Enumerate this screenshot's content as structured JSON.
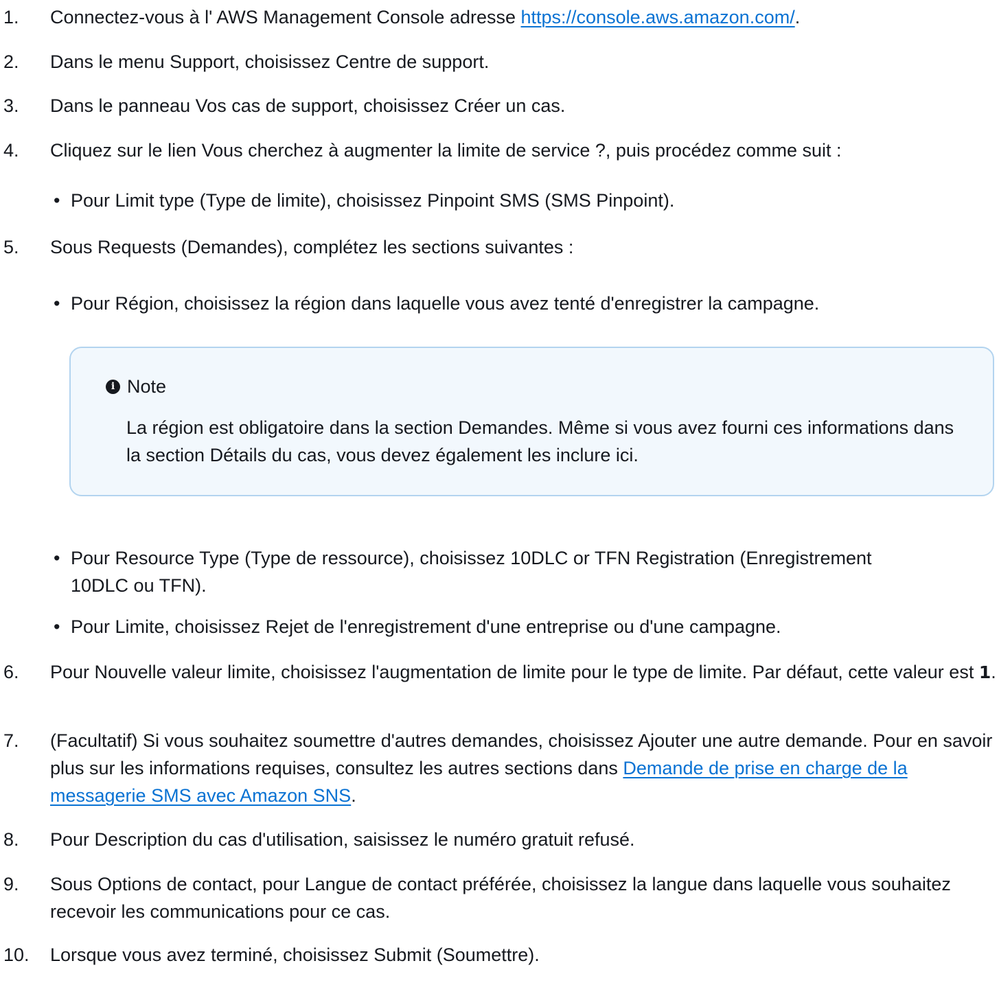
{
  "steps": [
    {
      "num": "1.",
      "before": "Connectez-vous à l' AWS Management Console adresse ",
      "link": "https://console.aws.amazon.com/",
      "after": "."
    },
    {
      "num": "2.",
      "text": "Dans le menu Support, choisissez Centre de support."
    },
    {
      "num": "3.",
      "text": "Dans le panneau Vos cas de support, choisissez Créer un cas."
    },
    {
      "num": "4.",
      "text": "Cliquez sur le lien Vous cherchez à augmenter la limite de service ?, puis procédez comme suit :"
    },
    {
      "num": "5.",
      "text": "Sous Requests (Demandes), complétez les sections suivantes :"
    },
    {
      "num": "6.",
      "before": "Pour Nouvelle valeur limite, choisissez l'augmentation de limite pour le type de limite. Par défaut, cette valeur est ",
      "bold": "1",
      "after": "."
    },
    {
      "num": "7.",
      "before": "(Facultatif) Si vous souhaitez soumettre d'autres demandes, choisissez Ajouter une autre demande. Pour en savoir plus sur les informations requises, consultez les autres sections dans ",
      "link": "Demande de prise en charge de la messagerie SMS avec Amazon SNS",
      "after": "."
    },
    {
      "num": "8.",
      "text": "Pour Description du cas d'utilisation, saisissez le numéro gratuit refusé."
    },
    {
      "num": "9.",
      "text": "Sous Options de contact, pour Langue de contact préférée, choisissez la langue dans laquelle vous souhaitez recevoir les communications pour ce cas."
    },
    {
      "num": "10.",
      "text": "Lorsque vous avez terminé, choisissez Submit (Soumettre)."
    }
  ],
  "bullets": {
    "limit_type": "Pour Limit type (Type de limite), choisissez Pinpoint SMS (SMS Pinpoint).",
    "region": "Pour Région, choisissez la région dans laquelle vous avez tenté d'enregistrer la campagne.",
    "resource_type": "Pour Resource Type (Type de ressource), choisissez 10DLC or TFN Registration (Enregistrement 10DLC ou TFN).",
    "limit": "Pour Limite, choisissez Rejet de l'enregistrement d'une entreprise ou d'une campagne."
  },
  "bullet_symbol": "•",
  "note": {
    "icon": "info-icon",
    "title": "Note",
    "body": "La région est obligatoire dans la section Demandes. Même si vous avez fourni ces informations dans la section Détails du cas, vous devez également les inclure ici."
  },
  "colors": {
    "text": "#16191f",
    "link": "#0972d3",
    "note_background": "#f2f8fd",
    "note_border": "#b3d4ef"
  }
}
